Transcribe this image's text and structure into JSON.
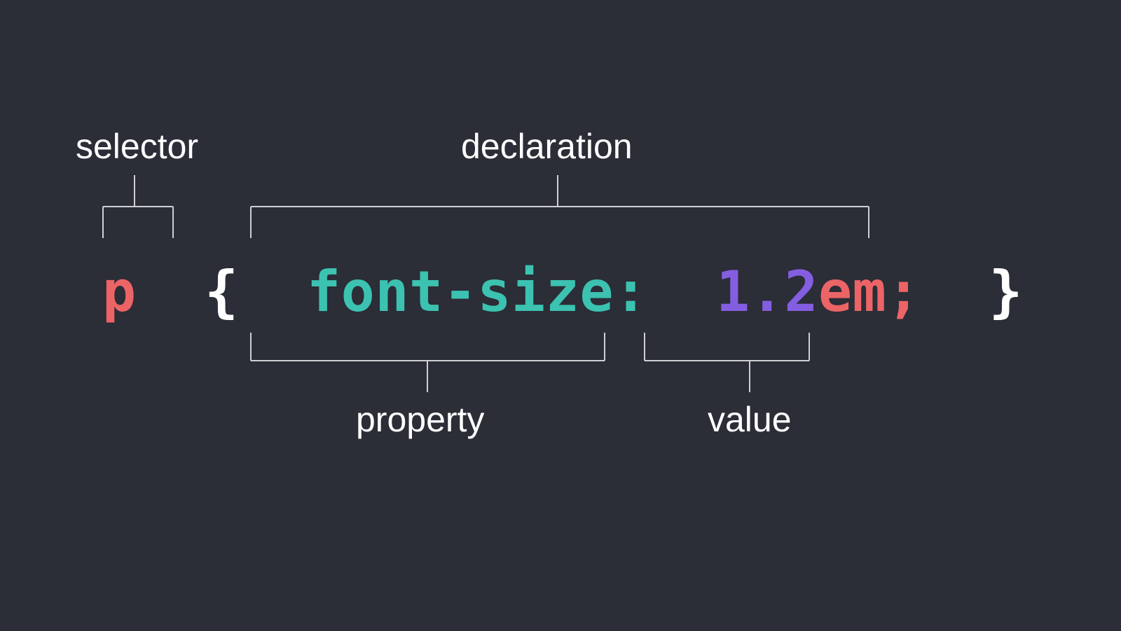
{
  "labels": {
    "selector": "selector",
    "declaration": "declaration",
    "property": "property",
    "value": "value"
  },
  "code": {
    "selector": "p",
    "brace_open": "{",
    "property": "font-size",
    "colon": ":",
    "value_number": "1.2",
    "value_unit": "em",
    "semicolon": ";",
    "brace_close": "}"
  },
  "colors": {
    "background": "#2b2d37",
    "label": "#ffffff",
    "bracket": "#cfd0d4",
    "selector": "#ec6466",
    "brace": "#ffffff",
    "property": "#3cc2b0",
    "number": "#845ee0",
    "unit": "#ec6466",
    "semicolon": "#ec6466"
  }
}
